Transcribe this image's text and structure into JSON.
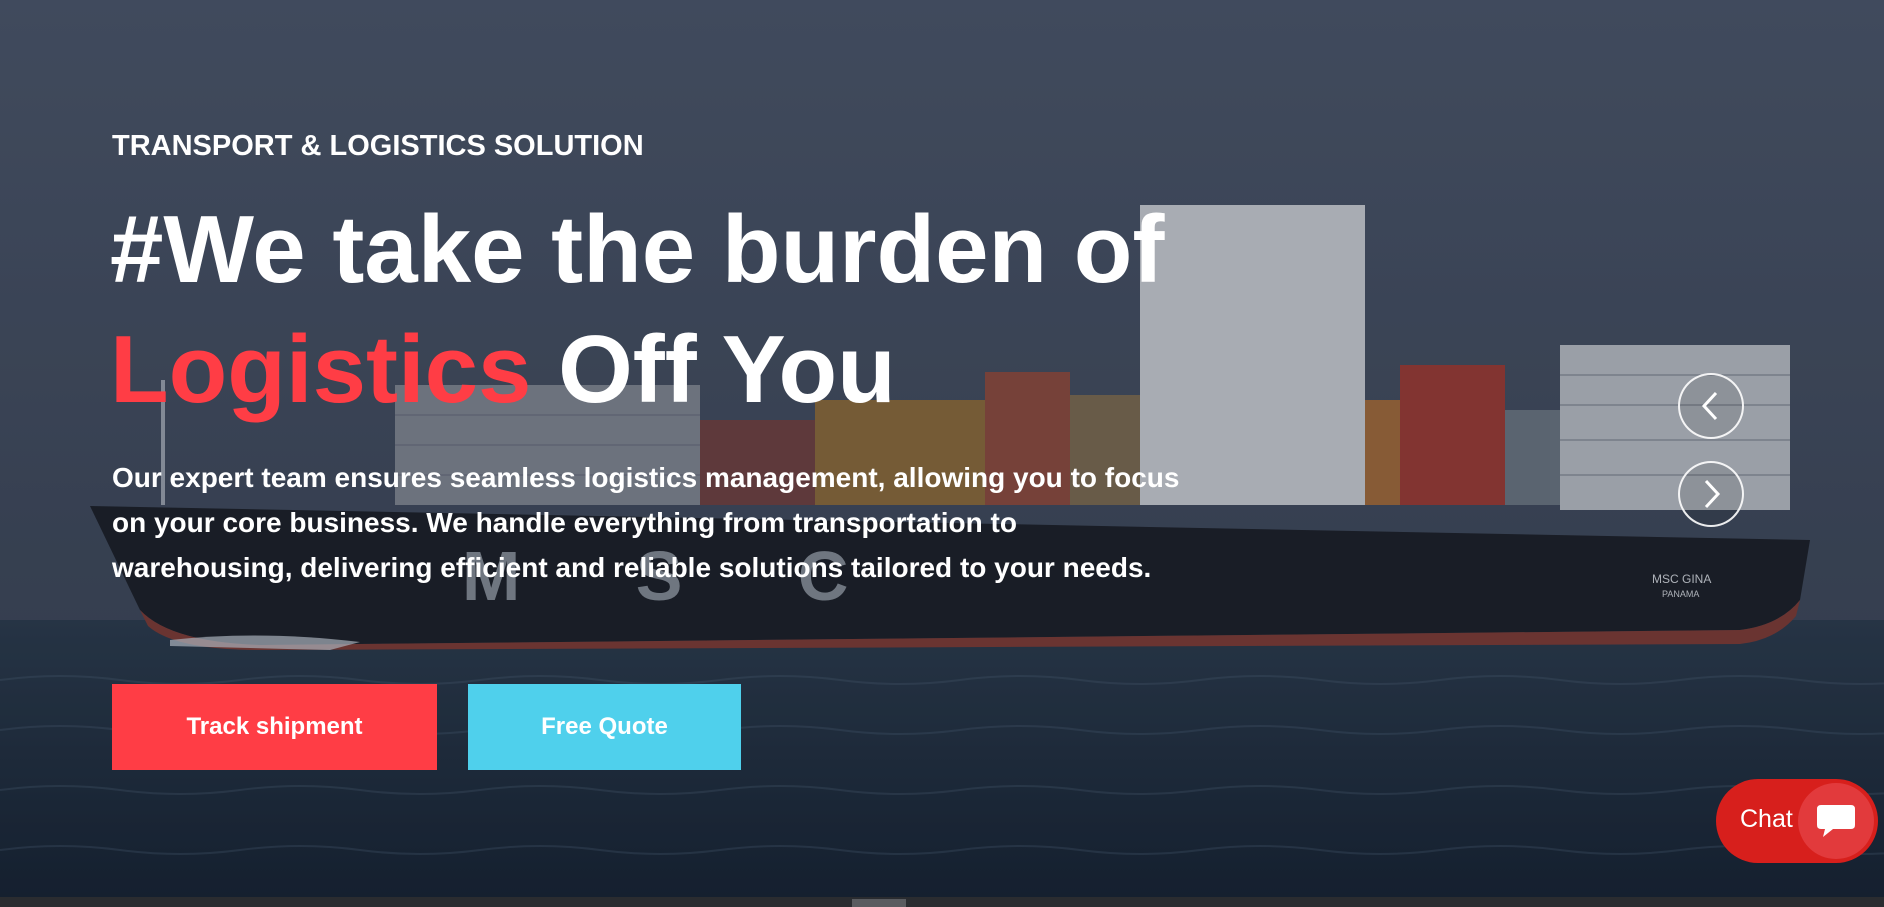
{
  "hero": {
    "eyebrow": "TRANSPORT & LOGISTICS SOLUTION",
    "headline_line1": "#We take the burden of",
    "headline_accent": "Logistics",
    "headline_rest": " Off You",
    "description": "Our expert team ensures seamless logistics management, allowing you to focus on your core business. We handle everything from transportation to warehousing, delivering efficient and reliable solutions tailored to your needs.",
    "ship_hull_text": "M S C",
    "ship_name": "MSC GINA",
    "ship_port": "PANAMA"
  },
  "buttons": {
    "track_label": "Track shipment",
    "quote_label": "Free Quote"
  },
  "slider": {
    "prev_icon": "chevron-left-icon",
    "next_icon": "chevron-right-icon"
  },
  "chat": {
    "label": "Chat",
    "icon": "chat-bubble-icon"
  },
  "colors": {
    "accent_red": "#ff3d45",
    "accent_cyan": "#4fd0ec",
    "chat_red": "#d71f1c"
  }
}
